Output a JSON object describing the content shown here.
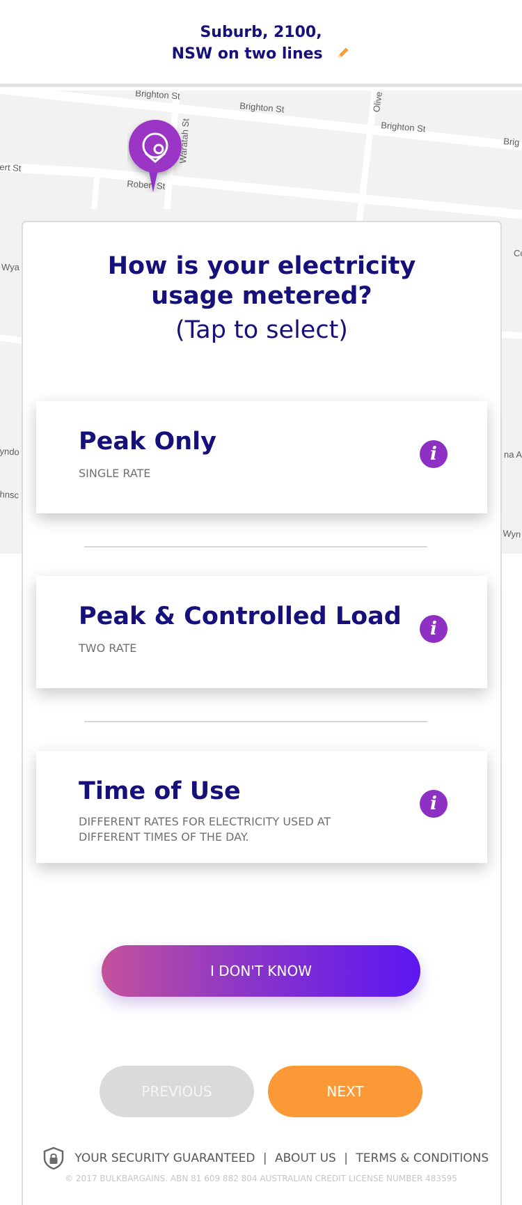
{
  "header": {
    "line1": "Suburb, 2100,",
    "line2": "NSW on two lines",
    "edit_icon": "pencil-icon"
  },
  "map": {
    "streets": [
      "Brighton St",
      "Brighton St",
      "Brighton St",
      "Brig",
      "Robert St",
      "ert St",
      "Waratah St",
      "Olive",
      "Wya",
      "yndo",
      "hnsc",
      "Co",
      "na Av",
      "Wyn"
    ],
    "pin_icon": "map-pin-icon"
  },
  "question": {
    "title_line1": "How is your electricity",
    "title_line2": "usage metered?",
    "subtitle": "(Tap to select)"
  },
  "options": [
    {
      "title": "Peak Only",
      "subtitle": "SINGLE RATE",
      "icon": "info-icon"
    },
    {
      "title": "Peak & Controlled Load",
      "subtitle": "TWO RATE",
      "icon": "info-icon"
    },
    {
      "title": "Time of Use",
      "subtitle": "DIFFERENT RATES FOR ELECTRICITY USED AT DIFFERENT TIMES OF THE DAY.",
      "icon": "info-icon"
    }
  ],
  "info_glyph": "i",
  "buttons": {
    "dont_know": "I DON'T KNOW",
    "previous": "PREVIOUS",
    "next": "NEXT"
  },
  "footer": {
    "security": "YOUR SECURITY GUARANTEED",
    "sep": "|",
    "about": "ABOUT US",
    "terms": "TERMS & CONDITIONS",
    "copyright": "© 2017 BULKBARGAINS. ABN 81 609 882 804 AUSTRALIAN CREDIT LICENSE NUMBER 483595",
    "shield_icon": "shield-lock-icon"
  },
  "colors": {
    "navy": "#15107a",
    "purple": "#8e30c4",
    "orange": "#fb9937",
    "gradient_start": "#c4529b",
    "gradient_end": "#5c16f2"
  }
}
